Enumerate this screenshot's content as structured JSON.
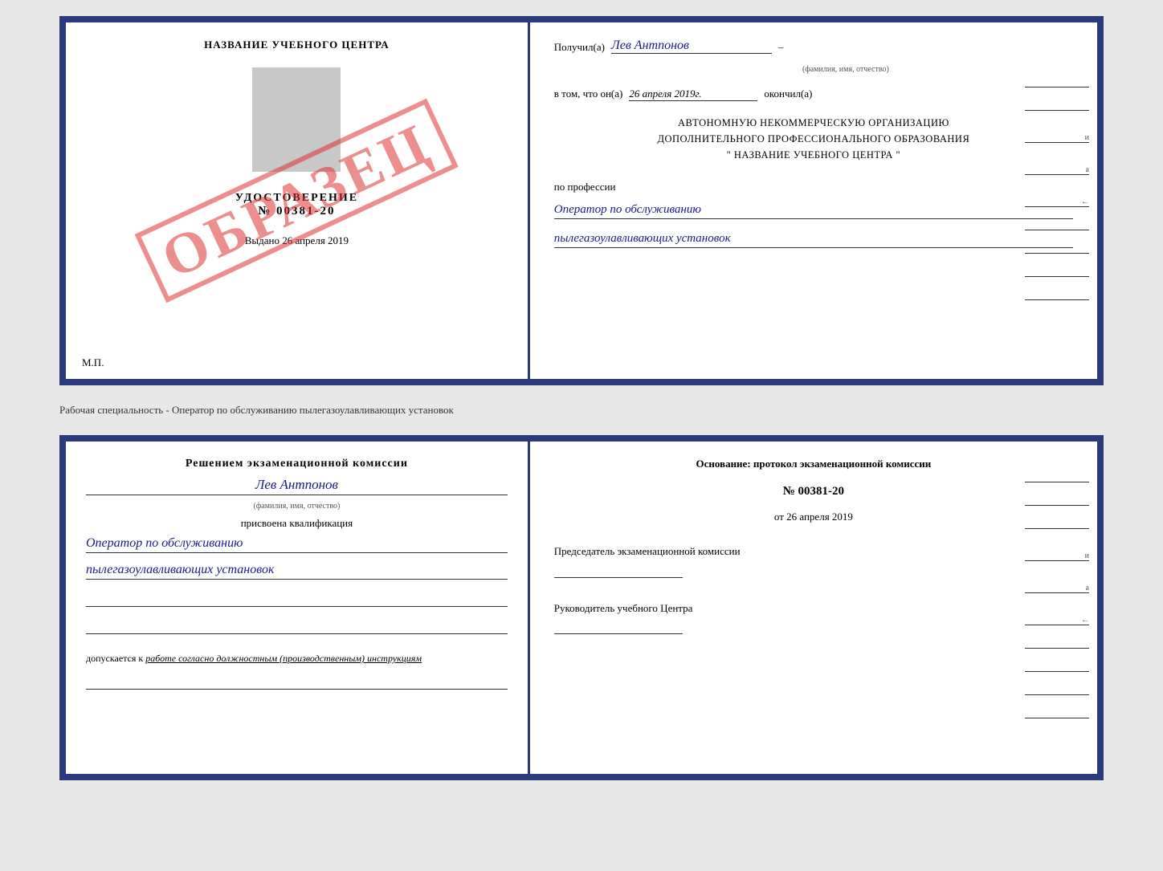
{
  "topCert": {
    "leftSide": {
      "schoolTitle": "НАЗВАНИЕ УЧЕБНОГО ЦЕНТРА",
      "udostLabel": "УДОСТОВЕРЕНИЕ",
      "udostNumber": "№ 00381-20",
      "vydanoLabel": "Выдано",
      "vydanoDate": "26 апреля 2019",
      "mpLabel": "М.П.",
      "obrazets": "ОБРАЗЕЦ"
    },
    "rightSide": {
      "poluchilLabel": "Получил(а)",
      "personName": "Лев Антпонов",
      "fioLabel": "(фамилия, имя, отчество)",
      "dash": "–",
      "vtomLabel": "в том, что он(а)",
      "date": "26 апреля 2019г.",
      "okonchilLabel": "окончил(а)",
      "orgLine1": "АВТОНОМНУЮ НЕКОММЕРЧЕСКУЮ ОРГАНИЗАЦИЮ",
      "orgLine2": "ДОПОЛНИТЕЛЬНОГО ПРОФЕССИОНАЛЬНОГО ОБРАЗОВАНИЯ",
      "orgNameQuoted": "\"  НАЗВАНИЕ УЧЕБНОГО ЦЕНТРА  \"",
      "poProfessiiLabel": "по профессии",
      "profLine1": "Оператор по обслуживанию",
      "profLine2": "пылегазоулавливающих установок"
    }
  },
  "middleLabel": "Рабочая специальность - Оператор по обслуживанию пылегазоулавливающих установок",
  "bottomCert": {
    "leftSide": {
      "resheniemTitle": "Решением экзаменационной комиссии",
      "personName": "Лев Антпонов",
      "fioLabel": "(фамилия, имя, отчество)",
      "prisvoenaLabel": "присвоена квалификация",
      "qualLine1": "Оператор по обслуживанию",
      "qualLine2": "пылегазоулавливающих установок",
      "dopuskaetsyaLabel": "допускается к",
      "dopuskaetsyaText": "работе согласно должностным (производственным) инструкциям"
    },
    "rightSide": {
      "osnovanieLabelPart1": "Основание: протокол экзаменационной комиссии",
      "protokolNumber": "№  00381-20",
      "otLabel": "от",
      "otDate": "26 апреля 2019",
      "predsedatelLabel": "Председатель экзаменационной комиссии",
      "rukovoditelLabel": "Руководитель учебного Центра"
    }
  }
}
